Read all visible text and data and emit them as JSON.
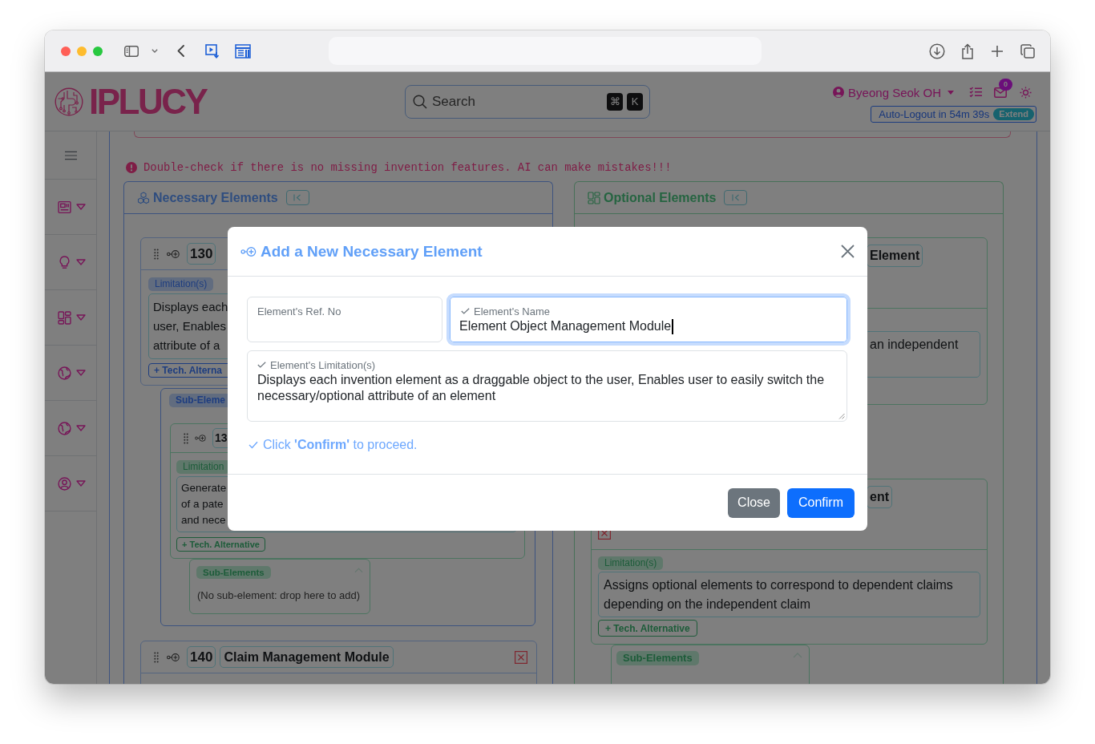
{
  "app_header": {
    "logo": "IPLUCY",
    "search": {
      "placeholder": "Search",
      "shortcut_keys": [
        "⌘",
        "K"
      ]
    },
    "user": {
      "name": "Byeong Seok OH"
    },
    "inbox": {
      "badge": "0"
    },
    "auto_logout": {
      "text": "Auto-Logout in 54m 39s",
      "button": "Extend"
    }
  },
  "sidebar": {
    "items": [
      {
        "kind": "board"
      },
      {
        "kind": "bulb"
      },
      {
        "kind": "grid"
      },
      {
        "kind": "globe"
      },
      {
        "kind": "globe"
      },
      {
        "kind": "user"
      }
    ]
  },
  "warning": "Double-check if there is no missing invention features. AI can make mistakes!!!",
  "panels": [
    {
      "kind": "necessary",
      "title": "Necessary Elements",
      "elements": [
        {
          "kind": "necessary",
          "ref": "130",
          "limitation_badge": "Limitation(s)",
          "limitation_fragments": [
            "Displays each",
            "user, Enables",
            "attribute of a"
          ],
          "alternative_button": "+ Tech. Alterna",
          "sub_elements": {
            "label": "Sub-Eleme",
            "elements": [
              {
                "kind": "optional",
                "ref": "13",
                "limitation_badge": "Limitation",
                "limitation_fragments": [
                  "Generate",
                  "of a pate",
                  "and nece"
                ],
                "alternative_button": "+ Tech. Alternative",
                "sub_elements": {
                  "label": "Sub-Elements",
                  "expanded": true,
                  "empty_text": "(No sub-element: drop here to add)"
                }
              }
            ]
          }
        },
        {
          "kind": "necessary",
          "ref": "140",
          "name": "Claim Management Module",
          "deletable": true
        }
      ]
    },
    {
      "kind": "optional",
      "title": "Optional Elements",
      "elements": [
        {
          "kind": "optional",
          "name": "Element",
          "limitation_fragments": [
            "an independent"
          ]
        },
        {
          "kind": "optional",
          "name": "ent",
          "deletable": true,
          "limitation_badge": "Limitation(s)",
          "limitation": "Assigns optional elements to correspond to dependent claims depending on the independent claim",
          "alternative_button": "+ Tech. Alternative",
          "sub_elements": {
            "label": "Sub-Elements",
            "expanded": true
          }
        }
      ]
    }
  ],
  "modal": {
    "title": "Add a New Necessary Element",
    "fields": [
      {
        "kind": "input",
        "label": "Element's Ref. No",
        "valid": false,
        "focused": false
      },
      {
        "kind": "input",
        "label": "Element's Name",
        "value": "Element Object Management Module",
        "valid": true,
        "focused": true
      },
      {
        "kind": "textarea",
        "label": "Element's Limitation(s)",
        "value": "Displays each invention element as a draggable object to the user, Enables user to easily switch the necessary/optional attribute of an element",
        "valid": true,
        "focused": false
      }
    ],
    "hint": "Click **'Confirm'** to proceed.",
    "buttons": [
      {
        "label": "Close",
        "kind": "secondary"
      },
      {
        "label": "Confirm",
        "kind": "primary"
      }
    ]
  }
}
